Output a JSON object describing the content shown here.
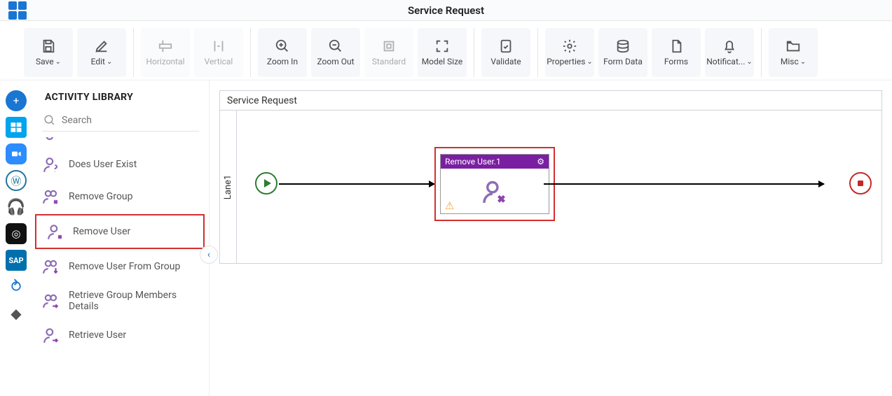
{
  "header": {
    "title": "Service Request"
  },
  "toolbar": {
    "save": "Save",
    "edit": "Edit",
    "horizontal": "Horizontal",
    "vertical": "Vertical",
    "zoomIn": "Zoom In",
    "zoomOut": "Zoom Out",
    "standard": "Standard",
    "modelSize": "Model Size",
    "validate": "Validate",
    "properties": "Properties",
    "formData": "Form Data",
    "forms": "Forms",
    "notifications": "Notificat...",
    "misc": "Misc"
  },
  "panel": {
    "title": "ACTIVITY LIBRARY",
    "searchPlaceholder": "Search",
    "items": {
      "doesUserExist": "Does User Exist",
      "removeGroup": "Remove Group",
      "removeUser": "Remove User",
      "removeUserFromGroup": "Remove User From Group",
      "retrieveGroupMembersDetails": "Retrieve Group Members Details",
      "retrieveUser": "Retrieve User"
    }
  },
  "canvas": {
    "title": "Service Request",
    "lane": "Lane1",
    "nodeTitle": "Remove User.1"
  }
}
